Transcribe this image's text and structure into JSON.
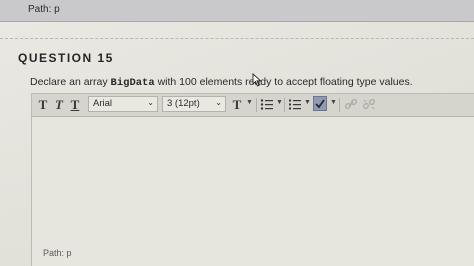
{
  "top_path": {
    "text": "Path: p"
  },
  "question": {
    "heading": "QUESTION 15",
    "prompt_before": "Declare an array ",
    "prompt_code": "BigData",
    "prompt_after": " with 100 elements ready to accept floating type values."
  },
  "toolbar": {
    "bold_t": "T",
    "italic_t": "T",
    "underline_t": "T",
    "font_family": "Arial",
    "font_size": "3 (12pt)",
    "text_color_t": "T",
    "chevron": "⌄"
  },
  "editor": {
    "body_text": "",
    "path_text": "Path: p"
  },
  "icons": {
    "cursor": "mouse-pointer",
    "bullet_list": "unordered-list",
    "numbered_list": "ordered-list",
    "spellcheck": "spellcheck",
    "link": "link",
    "unlink": "unlink"
  }
}
